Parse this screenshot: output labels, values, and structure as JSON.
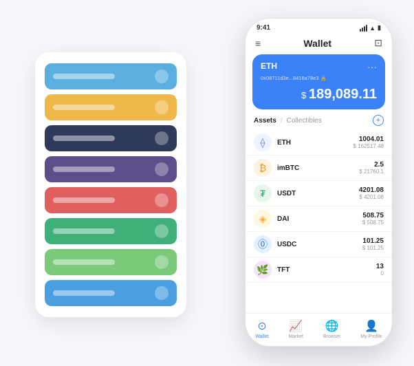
{
  "scene": {
    "bg_card": {
      "rows": [
        {
          "color": "#5aafe0",
          "label": "row-1"
        },
        {
          "color": "#f0b84b",
          "label": "row-2"
        },
        {
          "color": "#2e3a59",
          "label": "row-3"
        },
        {
          "color": "#5b4e8a",
          "label": "row-4"
        },
        {
          "color": "#e06060",
          "label": "row-5"
        },
        {
          "color": "#3fb07a",
          "label": "row-6"
        },
        {
          "color": "#7bc97a",
          "label": "row-7"
        },
        {
          "color": "#4a9fe0",
          "label": "row-8"
        }
      ]
    },
    "phone": {
      "status_time": "9:41",
      "header_title": "Wallet",
      "eth_card": {
        "coin": "ETH",
        "address": "0x08711d3e...8416a78e3 🔒",
        "balance_symbol": "$",
        "balance": "189,089.11"
      },
      "assets_tab": "Assets",
      "collectibles_tab": "Collectibles",
      "assets": [
        {
          "name": "ETH",
          "amount": "1004.01",
          "usd": "$ 162517.48",
          "icon": "⟠",
          "icon_bg": "#eef3ff",
          "icon_color": "#627eea"
        },
        {
          "name": "imBTC",
          "amount": "2.5",
          "usd": "$ 21760.1",
          "icon": "₿",
          "icon_bg": "#fff3e0",
          "icon_color": "#f7931a"
        },
        {
          "name": "USDT",
          "amount": "4201.08",
          "usd": "$ 4201.08",
          "icon": "₮",
          "icon_bg": "#e8f5e9",
          "icon_color": "#26a17b"
        },
        {
          "name": "DAI",
          "amount": "508.75",
          "usd": "$ 508.75",
          "icon": "◈",
          "icon_bg": "#fff8e1",
          "icon_color": "#f5ac37"
        },
        {
          "name": "USDC",
          "amount": "101.25",
          "usd": "$ 101.25",
          "icon": "⓪",
          "icon_bg": "#e3f0ff",
          "icon_color": "#2775ca"
        },
        {
          "name": "TFT",
          "amount": "13",
          "usd": "0",
          "icon": "🌿",
          "icon_bg": "#f3e5f5",
          "icon_color": "#ab47bc"
        }
      ],
      "nav": [
        {
          "label": "Wallet",
          "active": true
        },
        {
          "label": "Market",
          "active": false
        },
        {
          "label": "Browser",
          "active": false
        },
        {
          "label": "My Profile",
          "active": false
        }
      ]
    }
  }
}
